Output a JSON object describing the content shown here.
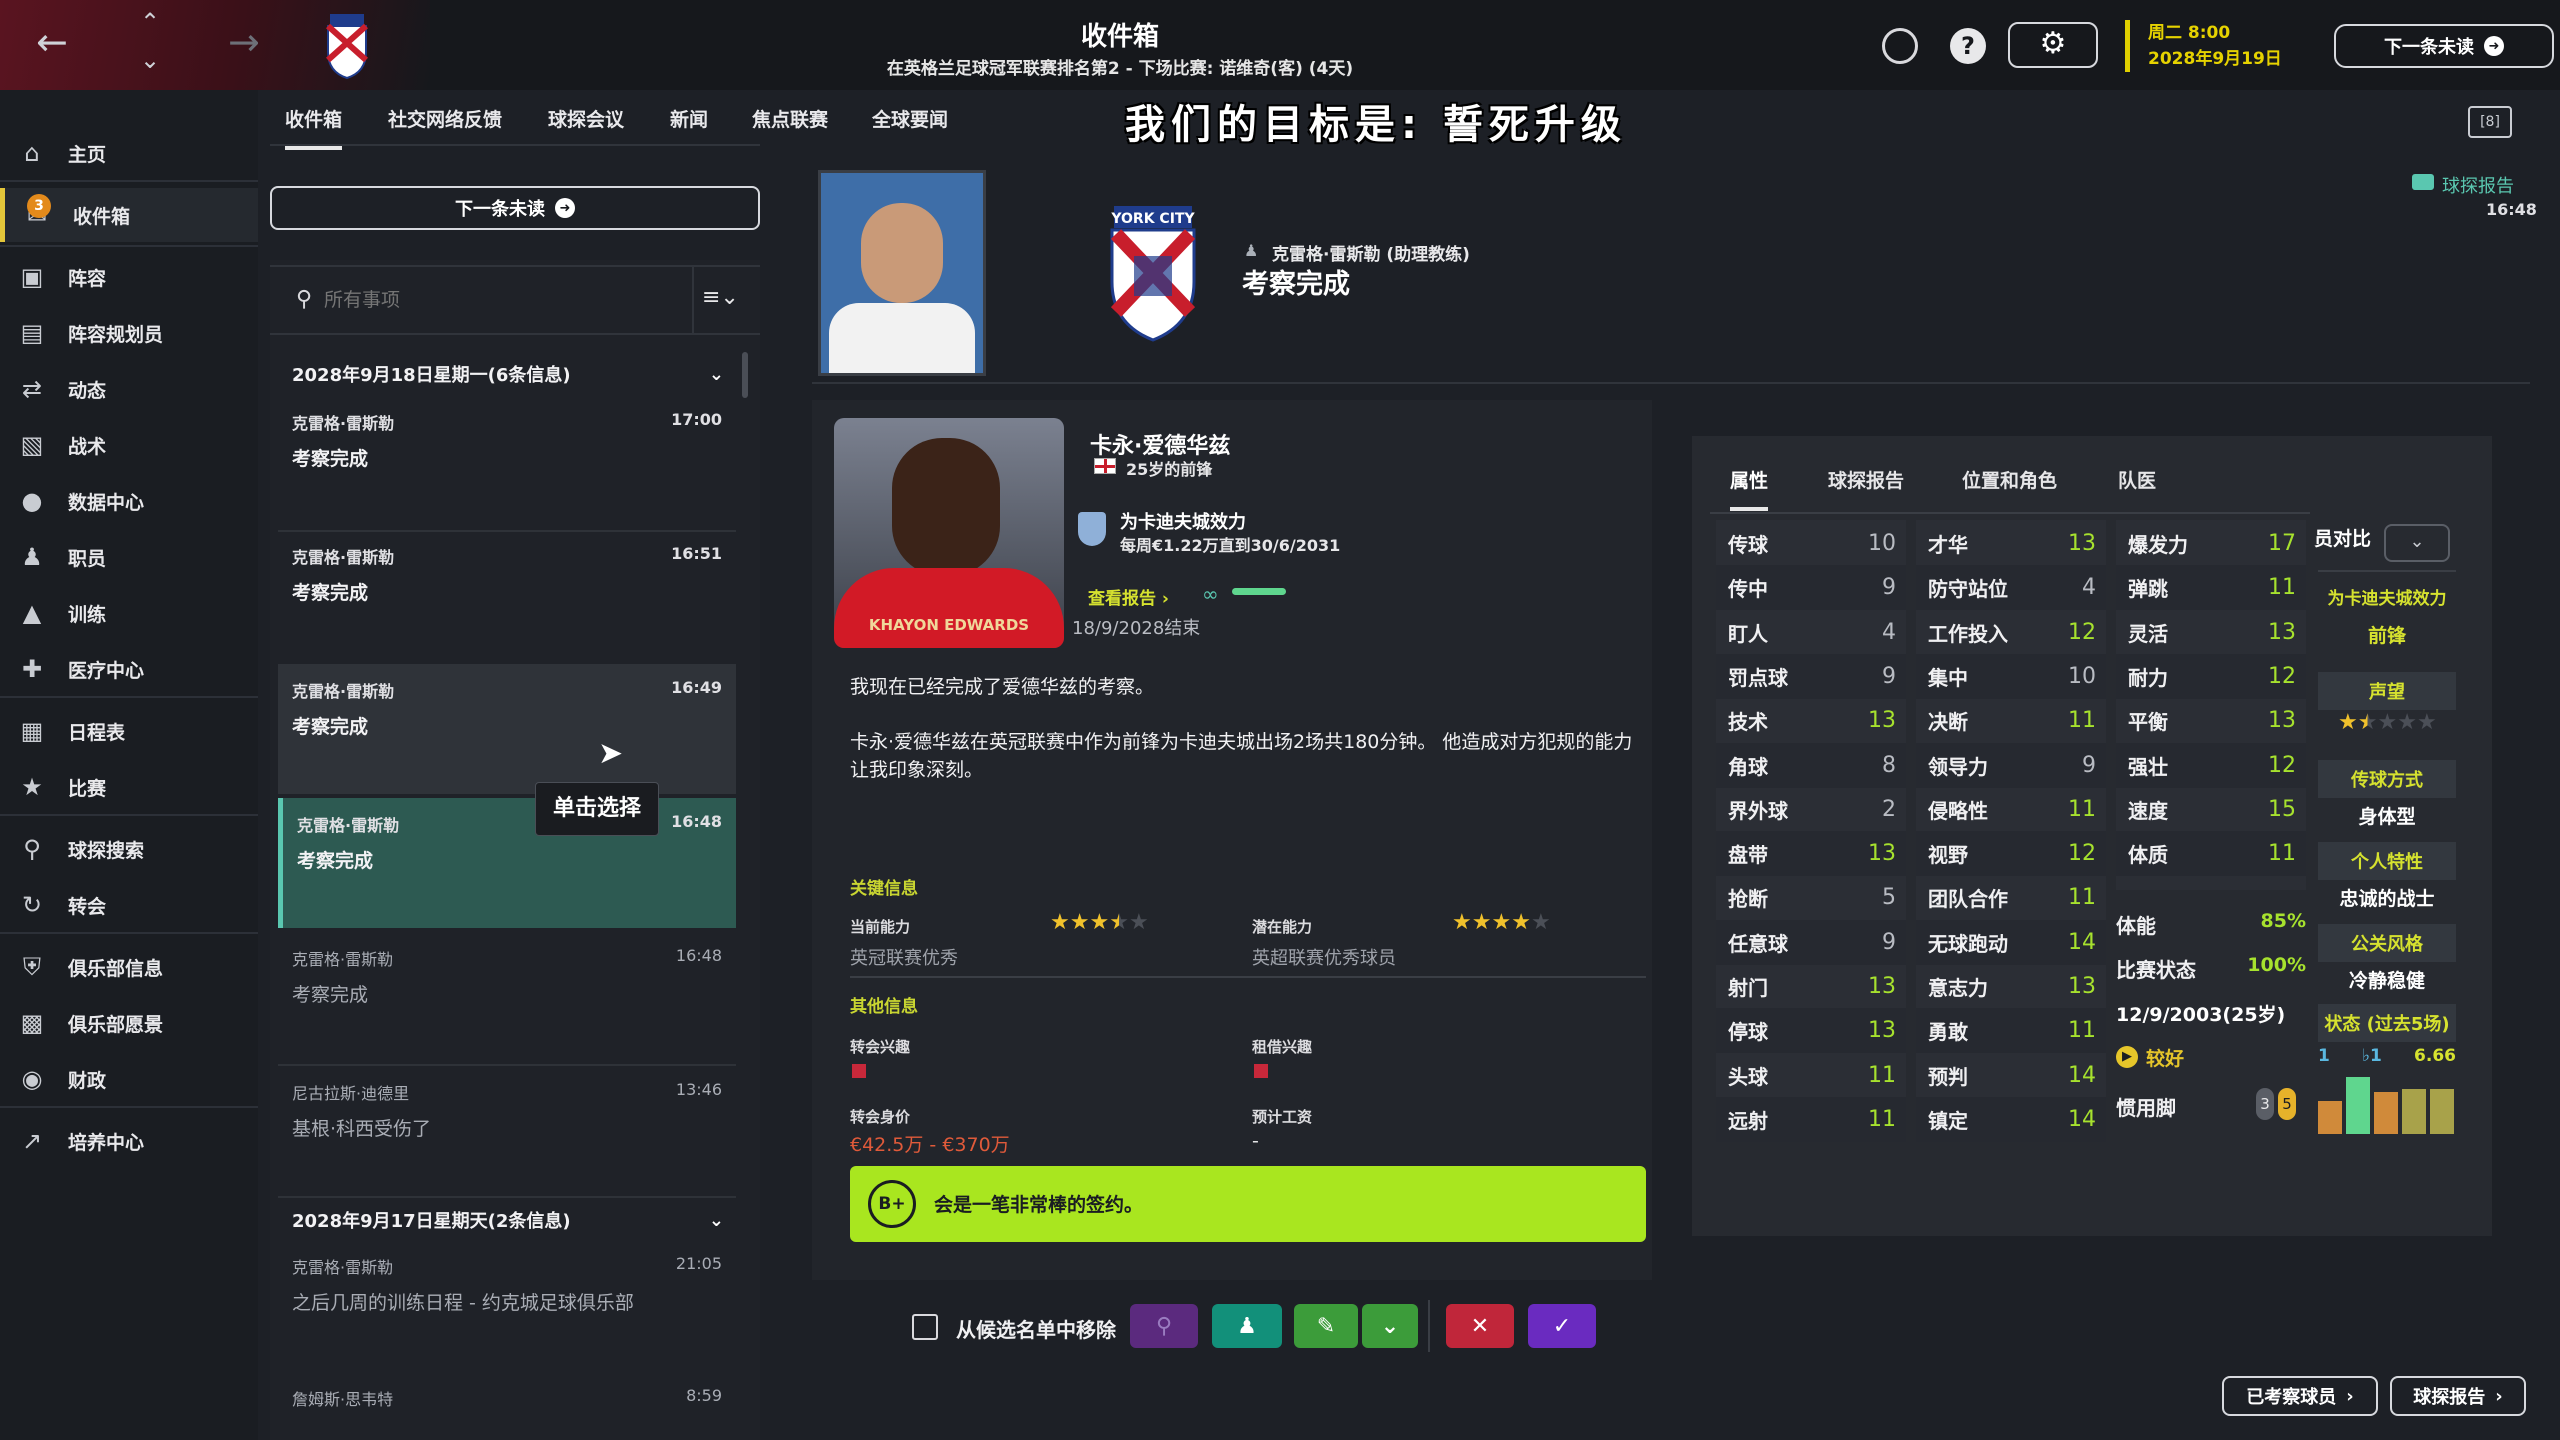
{
  "topbar": {
    "title": "收件箱",
    "subtitle": "在英格兰足球冠军联赛排名第2 - 下场比赛: 诺维奇(客) (4天)",
    "day_time": "周二 8:00",
    "date": "2028年9月19日",
    "next_unread": "下一条未读"
  },
  "sidebar": {
    "badge": "3",
    "items": [
      {
        "label": "主页",
        "icon": "home-icon"
      },
      {
        "label": "收件箱",
        "icon": "inbox-icon"
      },
      {
        "label": "阵容",
        "icon": "shirt-icon"
      },
      {
        "label": "阵容规划员",
        "icon": "clipboard-icon"
      },
      {
        "label": "动态",
        "icon": "dynamics-icon"
      },
      {
        "label": "战术",
        "icon": "tactics-icon"
      },
      {
        "label": "数据中心",
        "icon": "data-icon"
      },
      {
        "label": "职员",
        "icon": "staff-icon"
      },
      {
        "label": "训练",
        "icon": "training-icon"
      },
      {
        "label": "医疗中心",
        "icon": "medical-icon"
      },
      {
        "label": "日程表",
        "icon": "calendar-icon"
      },
      {
        "label": "比赛",
        "icon": "trophy-icon"
      },
      {
        "label": "球探搜索",
        "icon": "search-icon"
      },
      {
        "label": "转会",
        "icon": "transfer-icon"
      },
      {
        "label": "俱乐部信息",
        "icon": "shield-icon"
      },
      {
        "label": "俱乐部愿景",
        "icon": "briefcase-icon"
      },
      {
        "label": "财政",
        "icon": "money-icon"
      },
      {
        "label": "培养中心",
        "icon": "growth-icon"
      }
    ]
  },
  "tabs": [
    "收件箱",
    "社交网络反馈",
    "球探会议",
    "新闻",
    "焦点联赛",
    "全球要闻"
  ],
  "banner": "我们的目标是: 誓死升级",
  "inbox": {
    "next_unread_btn": "下一条未读",
    "search_placeholder": "所有事项",
    "group1": "2028年9月18日星期一(6条信息)",
    "group2": "2028年9月17日星期天(2条信息)",
    "tooltip": "单击选择",
    "messages": [
      {
        "from": "克雷格·雷斯勒",
        "subject": "考察完成",
        "time": "17:00"
      },
      {
        "from": "克雷格·雷斯勒",
        "subject": "考察完成",
        "time": "16:51"
      },
      {
        "from": "克雷格·雷斯勒",
        "subject": "考察完成",
        "time": "16:49"
      },
      {
        "from": "克雷格·雷斯勒",
        "subject": "考察完成",
        "time": "16:48"
      },
      {
        "from": "克雷格·雷斯勒",
        "subject": "考察完成",
        "time": "16:48"
      },
      {
        "from": "尼古拉斯·迪德里",
        "subject": "基根·科西受伤了",
        "time": "13:46"
      },
      {
        "from": "克雷格·雷斯勒",
        "subject": "之后几周的训练日程 - 约克城足球俱乐部",
        "time": "21:05"
      },
      {
        "from": "詹姆斯·思韦特",
        "subject": "",
        "time": "8:59"
      }
    ]
  },
  "message": {
    "sender": "克雷格·雷斯勒 (助理教练)",
    "title": "考察完成",
    "tag": "球探报告",
    "tag_time": "16:48"
  },
  "player": {
    "name": "卡永·爱德华兹",
    "age_pos": "25岁的前锋",
    "club_line": "为卡迪夫城效力",
    "contract": "每周€1.22万直到30/6/2031",
    "view_report": "查看报告",
    "scouted_date": "18/9/2028结束",
    "shirt_text": "KHAYON EDWARDS",
    "body1": "我现在已经完成了爱德华兹的考察。",
    "body2": "卡永·爱德华兹在英冠联赛中作为前锋为卡迪夫城出场2场共180分钟。 他造成对方犯规的能力让我印象深刻。",
    "key_info": "关键信息",
    "current_ability_lbl": "当前能力",
    "current_ability_val": "英冠联赛优秀",
    "potential_ability_lbl": "潜在能力",
    "potential_ability_val": "英超联赛优秀球员",
    "other_info": "其他信息",
    "transfer_interest_lbl": "转会兴趣",
    "loan_interest_lbl": "租借兴趣",
    "value_lbl": "转会身价",
    "value": "€42.5万 - €370万",
    "wage_lbl": "预计工资",
    "wage": "-",
    "grade": "B+",
    "verdict": "会是一笔非常棒的签约。",
    "current_stars": 3.5,
    "potential_stars": 4
  },
  "attr_tabs": [
    "属性",
    "球探报告",
    "位置和角色",
    "队医"
  ],
  "technical": [
    {
      "n": "传球",
      "v": "10"
    },
    {
      "n": "传中",
      "v": "9"
    },
    {
      "n": "盯人",
      "v": "4"
    },
    {
      "n": "罚点球",
      "v": "9"
    },
    {
      "n": "技术",
      "v": "13"
    },
    {
      "n": "角球",
      "v": "8"
    },
    {
      "n": "界外球",
      "v": "2"
    },
    {
      "n": "盘带",
      "v": "13"
    },
    {
      "n": "抢断",
      "v": "5"
    },
    {
      "n": "任意球",
      "v": "9"
    },
    {
      "n": "射门",
      "v": "13"
    },
    {
      "n": "停球",
      "v": "13"
    },
    {
      "n": "头球",
      "v": "11"
    },
    {
      "n": "远射",
      "v": "11"
    }
  ],
  "mental": [
    {
      "n": "才华",
      "v": "13"
    },
    {
      "n": "防守站位",
      "v": "4"
    },
    {
      "n": "工作投入",
      "v": "12"
    },
    {
      "n": "集中",
      "v": "10"
    },
    {
      "n": "决断",
      "v": "11"
    },
    {
      "n": "领导力",
      "v": "9"
    },
    {
      "n": "侵略性",
      "v": "11"
    },
    {
      "n": "视野",
      "v": "12"
    },
    {
      "n": "团队合作",
      "v": "11"
    },
    {
      "n": "无球跑动",
      "v": "14"
    },
    {
      "n": "意志力",
      "v": "13"
    },
    {
      "n": "勇敢",
      "v": "11"
    },
    {
      "n": "预判",
      "v": "14"
    },
    {
      "n": "镇定",
      "v": "14"
    }
  ],
  "physical": [
    {
      "n": "爆发力",
      "v": "17"
    },
    {
      "n": "弹跳",
      "v": "11"
    },
    {
      "n": "灵活",
      "v": "13"
    },
    {
      "n": "耐力",
      "v": "12"
    },
    {
      "n": "平衡",
      "v": "13"
    },
    {
      "n": "强壮",
      "v": "12"
    },
    {
      "n": "速度",
      "v": "15"
    },
    {
      "n": "体质",
      "v": "11"
    }
  ],
  "condition": {
    "fitness_lbl": "体能",
    "fitness": "85%",
    "match_lbl": "比赛状态",
    "match": "100%",
    "dob": "12/9/2003(25岁)",
    "morale": "较好",
    "foot_lbl": "惯用脚",
    "foot_l": "3",
    "foot_r": "5"
  },
  "right_col": {
    "compare": "员对比",
    "club": "为卡迪夫城效力",
    "position": "前锋",
    "rep_lbl": "声望",
    "passing_lbl": "传球方式",
    "passing": "身体型",
    "trait_lbl": "个人特性",
    "trait": "忠诚的战士",
    "media_lbl": "公关风格",
    "media": "冷静稳健",
    "form_lbl": "状态 (过去5场)",
    "form_avg": "6.66",
    "form_a": "1",
    "form_b": "1",
    "form_bars": [
      0.55,
      0.95,
      0.7,
      0.75,
      0.75
    ],
    "reputation_stars": 1.5
  },
  "bottom": {
    "remove_shortlist": "从候选名单中移除",
    "scouted_players": "已考察球员",
    "scout_report": "球探报告"
  },
  "colors": {
    "accent_green": "#a7e22e",
    "verdict_bar": "#a9e61f",
    "selected_msg": "#2d5a52",
    "date_yellow": "#e6d200"
  }
}
